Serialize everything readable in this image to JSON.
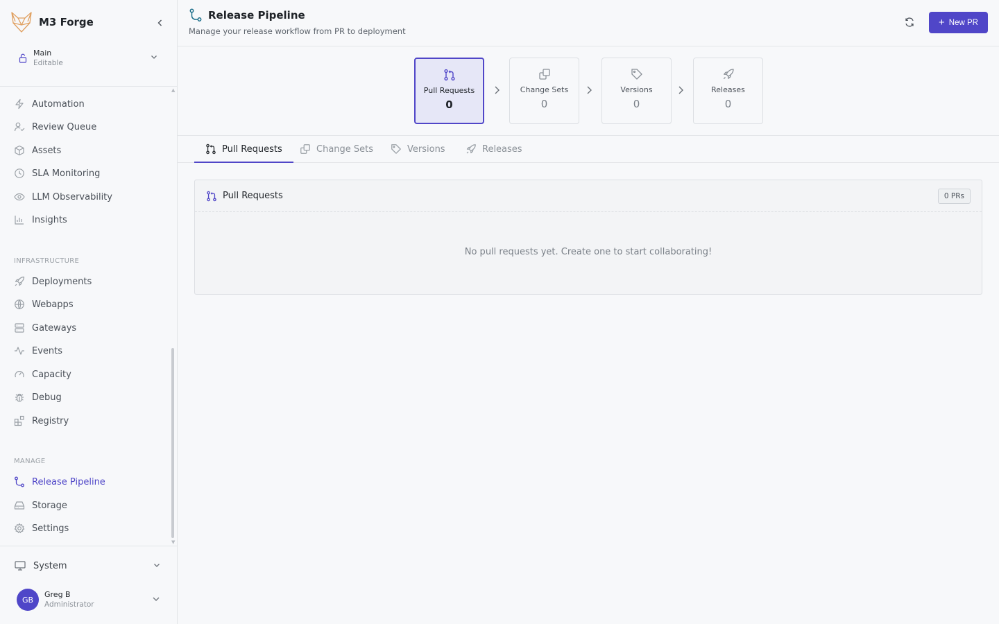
{
  "app": {
    "name": "M3 Forge",
    "workspace": {
      "name": "Main",
      "status": "Editable"
    }
  },
  "sidebar": {
    "items": [
      {
        "label": "Automation",
        "icon": "zap-icon"
      },
      {
        "label": "Review Queue",
        "icon": "user-check-icon"
      },
      {
        "label": "Assets",
        "icon": "box-icon"
      },
      {
        "label": "SLA Monitoring",
        "icon": "clock-icon"
      },
      {
        "label": "LLM Observability",
        "icon": "eye-icon"
      },
      {
        "label": "Insights",
        "icon": "bar-chart-icon"
      }
    ],
    "infrastructure_heading": "INFRASTRUCTURE",
    "infrastructure": [
      {
        "label": "Deployments",
        "icon": "rocket-icon"
      },
      {
        "label": "Webapps",
        "icon": "globe-icon"
      },
      {
        "label": "Gateways",
        "icon": "server-icon"
      },
      {
        "label": "Events",
        "icon": "activity-icon"
      },
      {
        "label": "Capacity",
        "icon": "gauge-icon"
      },
      {
        "label": "Debug",
        "icon": "bug-icon"
      },
      {
        "label": "Registry",
        "icon": "blocks-icon"
      }
    ],
    "manage_heading": "MANAGE",
    "manage": [
      {
        "label": "Release Pipeline",
        "icon": "route-icon",
        "active": true
      },
      {
        "label": "Storage",
        "icon": "hard-drive-icon"
      },
      {
        "label": "Settings",
        "icon": "gear-icon"
      }
    ],
    "system_label": "System",
    "user": {
      "initials": "GB",
      "name": "Greg B",
      "role": "Administrator"
    }
  },
  "header": {
    "title": "Release Pipeline",
    "subtitle": "Manage your release workflow from PR to deployment",
    "new_button_label": "New PR"
  },
  "stages": [
    {
      "label": "Pull Requests",
      "count": "0",
      "icon": "git-pull-request-icon",
      "active": true
    },
    {
      "label": "Change Sets",
      "count": "0",
      "icon": "copy-icon"
    },
    {
      "label": "Versions",
      "count": "0",
      "icon": "tag-icon"
    },
    {
      "label": "Releases",
      "count": "0",
      "icon": "rocket-icon"
    }
  ],
  "tabs": [
    {
      "label": "Pull Requests",
      "active": true
    },
    {
      "label": "Change Sets"
    },
    {
      "label": "Versions"
    },
    {
      "label": "Releases"
    }
  ],
  "panel": {
    "title": "Pull Requests",
    "badge": "0 PRs",
    "empty_message": "No pull requests yet. Create one to start collaborating!"
  },
  "colors": {
    "accent": "#5046c8",
    "accent_soft": "#e6e7f7",
    "background": "#f7f8fa",
    "border": "#e3e5e8"
  }
}
